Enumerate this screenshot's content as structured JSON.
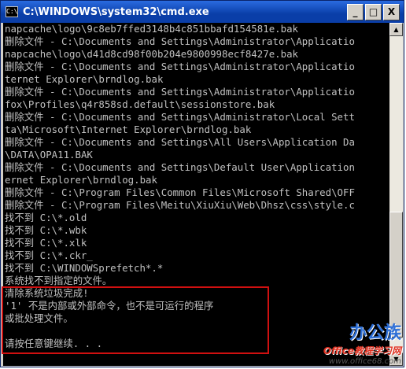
{
  "window": {
    "title": "C:\\WINDOWS\\system32\\cmd.exe",
    "icon_label": "C:\\",
    "minimize_glyph": "_",
    "maximize_glyph": "□",
    "close_glyph": "X"
  },
  "console": {
    "lines": [
      "napcache\\logo\\9c8eb7ffed3148b4c851bbafd154581e.bak",
      "删除文件 - C:\\Documents and Settings\\Administrator\\Applicatio",
      "napcache\\logo\\d41d8cd98f00b204e9800998ecf8427e.bak",
      "删除文件 - C:\\Documents and Settings\\Administrator\\Applicatio",
      "ternet Explorer\\brndlog.bak",
      "删除文件 - C:\\Documents and Settings\\Administrator\\Applicatio",
      "fox\\Profiles\\q4r858sd.default\\sessionstore.bak",
      "删除文件 - C:\\Documents and Settings\\Administrator\\Local Sett",
      "ta\\Microsoft\\Internet Explorer\\brndlog.bak",
      "删除文件 - C:\\Documents and Settings\\All Users\\Application Da",
      "\\DATA\\OPA11.BAK",
      "删除文件 - C:\\Documents and Settings\\Default User\\Application",
      "ernet Explorer\\brndlog.bak",
      "删除文件 - C:\\Program Files\\Common Files\\Microsoft Shared\\OFF",
      "删除文件 - C:\\Program Files\\Meitu\\XiuXiu\\Web\\Dhsz\\css\\style.c",
      "找不到 C:\\*.old",
      "找不到 C:\\*.wbk",
      "找不到 C:\\*.xlk",
      "找不到 C:\\*.ckr_",
      "找不到 C:\\WINDOWSprefetch*.*",
      "系统找不到指定的文件。",
      "清除系统垃圾完成!",
      "'1' 不是内部或外部命令，也不是可运行的程序",
      "或批处理文件。",
      "",
      "请按任意键继续. . ."
    ]
  },
  "scrollbar": {
    "up_glyph": "▲",
    "down_glyph": "▼"
  },
  "watermark": {
    "logo": "办公族",
    "sub": "Office教程学习网",
    "url": "www.office68.com"
  }
}
